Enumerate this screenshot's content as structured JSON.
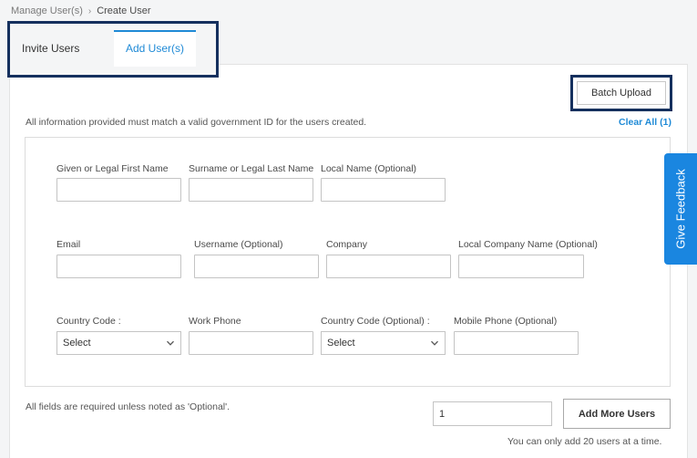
{
  "breadcrumb": {
    "parent": "Manage User(s)",
    "current": "Create User"
  },
  "tabs": [
    {
      "label": "Invite Users",
      "active": false
    },
    {
      "label": "Add User(s)",
      "active": true
    }
  ],
  "toolbar": {
    "batch_upload_label": "Batch Upload"
  },
  "info_note": "All information provided must match a valid government ID for the users created.",
  "clear_all_label": "Clear All (1)",
  "form": {
    "first_name_label": "Given or Legal First Name",
    "last_name_label": "Surname or Legal Last Name",
    "local_name_label": "Local Name (Optional)",
    "email_label": "Email",
    "username_label": "Username (Optional)",
    "company_label": "Company",
    "local_company_label": "Local Company Name (Optional)",
    "country_code_label": "Country Code :",
    "work_phone_label": "Work Phone",
    "country_code_optional_label": "Country Code (Optional) :",
    "mobile_phone_label": "Mobile Phone (Optional)",
    "country_code_value": "Select",
    "country_code_optional_value": "Select",
    "first_name_value": "",
    "last_name_value": "",
    "local_name_value": "",
    "email_value": "",
    "username_value": "",
    "company_value": "",
    "local_company_value": "",
    "work_phone_value": "",
    "mobile_phone_value": ""
  },
  "feedback_label": "Give Feedback",
  "footer": {
    "required_note": "All fields are required unless noted as 'Optional'.",
    "user_count_value": "1",
    "add_more_label": "Add More Users",
    "limit_note": "You can only add 20 users at a time."
  },
  "colors": {
    "accent": "#1f8ad6",
    "highlight_frame": "#15305e",
    "feedback_bg": "#1a86e0"
  }
}
